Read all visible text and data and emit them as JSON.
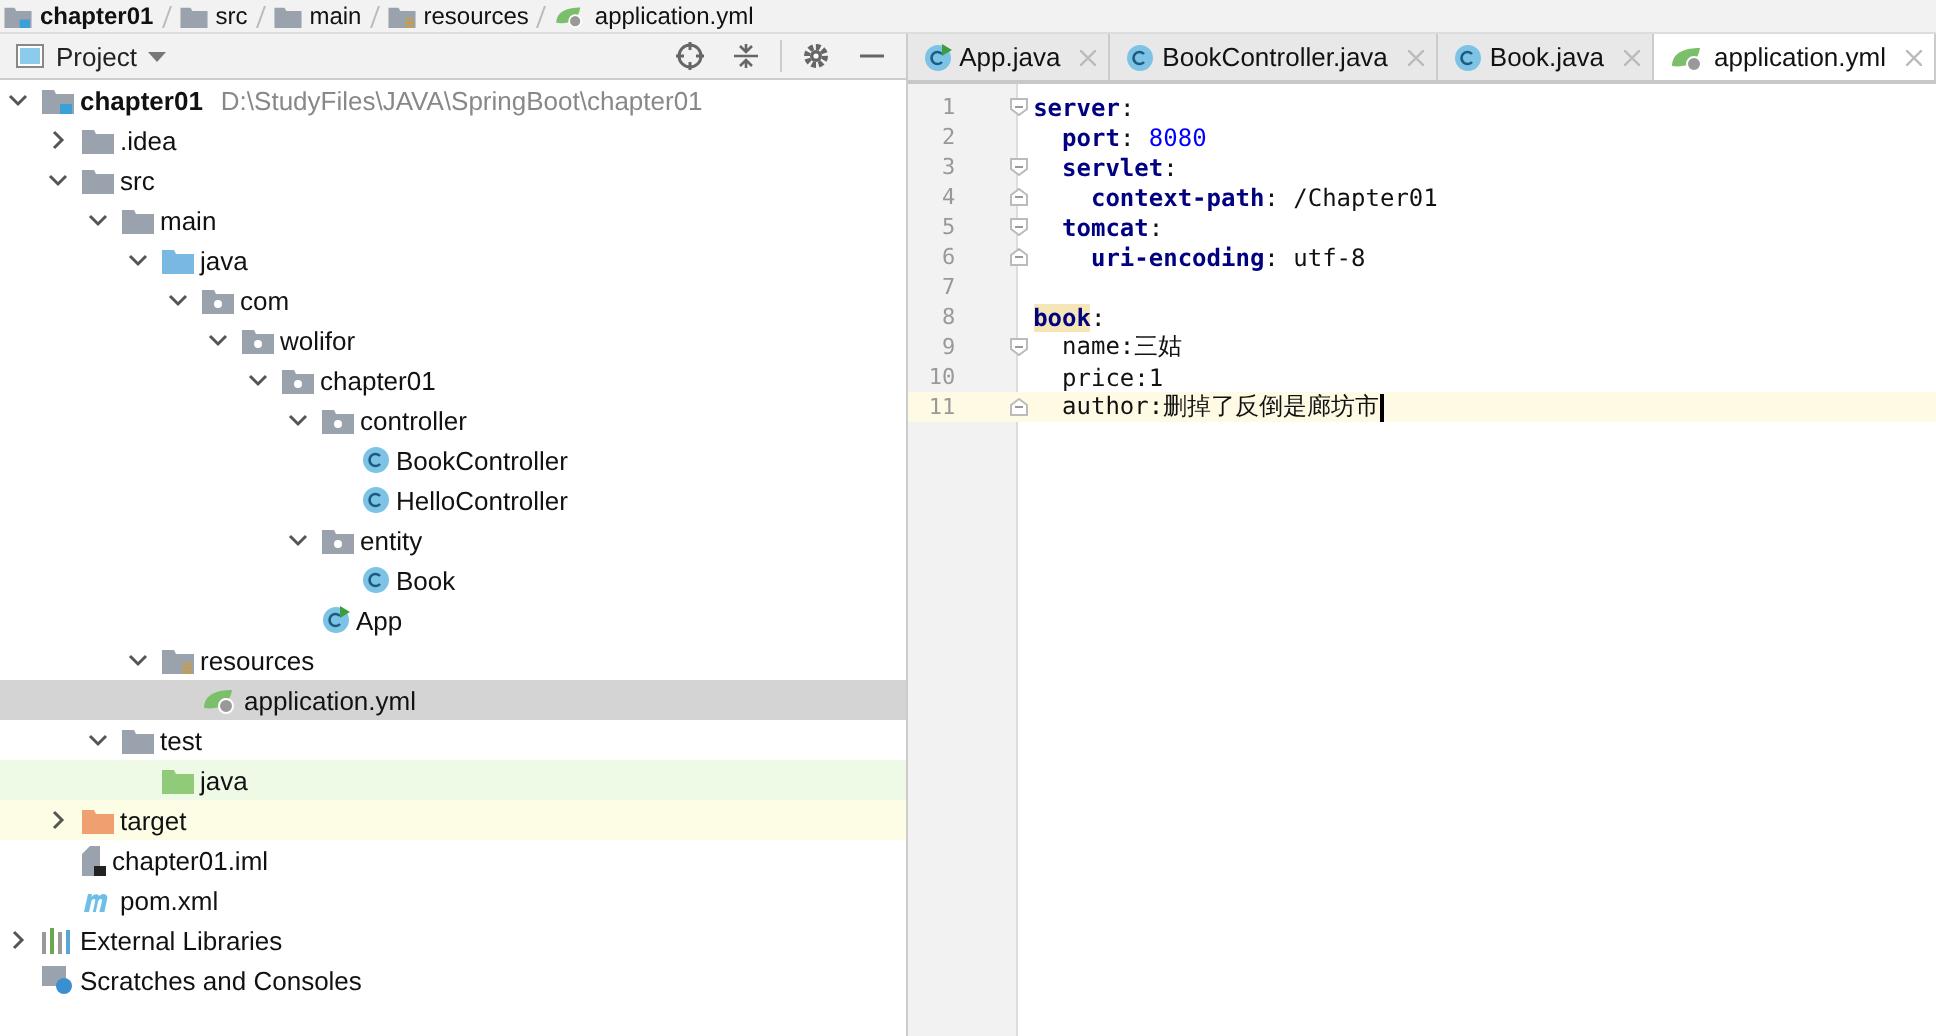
{
  "breadcrumb": [
    {
      "label": "chapter01",
      "kind": "module"
    },
    {
      "label": "src",
      "kind": "folder"
    },
    {
      "label": "main",
      "kind": "folder"
    },
    {
      "label": "resources",
      "kind": "resources"
    },
    {
      "label": "application.yml",
      "kind": "yml"
    }
  ],
  "project_panel": {
    "title": "Project",
    "tree": [
      {
        "label": "chapter01",
        "path": "D:\\StudyFiles\\JAVA\\SpringBoot\\chapter01",
        "kind": "module",
        "expanded": true,
        "selected": false,
        "children": [
          {
            "label": ".idea",
            "kind": "folder",
            "expanded": false,
            "selected": false
          },
          {
            "label": "src",
            "kind": "folder",
            "expanded": true,
            "selected": false,
            "children": [
              {
                "label": "main",
                "kind": "folder",
                "expanded": true,
                "selected": false,
                "children": [
                  {
                    "label": "java",
                    "kind": "source",
                    "expanded": true,
                    "selected": false,
                    "children": [
                      {
                        "label": "com",
                        "kind": "package",
                        "expanded": true,
                        "selected": false,
                        "children": [
                          {
                            "label": "wolifor",
                            "kind": "package",
                            "expanded": true,
                            "selected": false,
                            "children": [
                              {
                                "label": "chapter01",
                                "kind": "package",
                                "expanded": true,
                                "selected": false,
                                "children": [
                                  {
                                    "label": "controller",
                                    "kind": "package",
                                    "expanded": true,
                                    "selected": false,
                                    "children": [
                                      {
                                        "label": "BookController",
                                        "kind": "class",
                                        "selected": false
                                      },
                                      {
                                        "label": "HelloController",
                                        "kind": "class",
                                        "selected": false
                                      }
                                    ]
                                  },
                                  {
                                    "label": "entity",
                                    "kind": "package",
                                    "expanded": true,
                                    "selected": false,
                                    "children": [
                                      {
                                        "label": "Book",
                                        "kind": "class",
                                        "selected": false
                                      }
                                    ]
                                  },
                                  {
                                    "label": "App",
                                    "kind": "app",
                                    "selected": false
                                  }
                                ]
                              }
                            ]
                          }
                        ]
                      }
                    ]
                  },
                  {
                    "label": "resources",
                    "kind": "resources",
                    "expanded": true,
                    "selected": false,
                    "children": [
                      {
                        "label": "application.yml",
                        "kind": "yml",
                        "selected": true
                      }
                    ]
                  }
                ]
              },
              {
                "label": "test",
                "kind": "folder",
                "expanded": true,
                "selected": false,
                "children": [
                  {
                    "label": "java",
                    "kind": "test",
                    "selected": false
                  }
                ]
              }
            ]
          },
          {
            "label": "target",
            "kind": "excluded",
            "expanded": false,
            "selected": false
          },
          {
            "label": "chapter01.iml",
            "kind": "iml",
            "selected": false
          },
          {
            "label": "pom.xml",
            "kind": "maven",
            "selected": false
          }
        ]
      },
      {
        "label": "External Libraries",
        "kind": "libraries",
        "expanded": false,
        "selected": false
      },
      {
        "label": "Scratches and Consoles",
        "kind": "scratches",
        "selected": false
      }
    ]
  },
  "editor": {
    "tabs": [
      {
        "label": "App.java",
        "kind": "app",
        "selected": false
      },
      {
        "label": "BookController.java",
        "kind": "class",
        "selected": false
      },
      {
        "label": "Book.java",
        "kind": "class",
        "selected": false
      },
      {
        "label": "application.yml",
        "kind": "yml",
        "selected": true
      }
    ],
    "lines": [
      {
        "number": "1",
        "kind": "fold-start",
        "current": false,
        "segments": [
          {
            "text": "server",
            "kind": "key"
          },
          {
            "text": ":",
            "kind": "plain"
          }
        ]
      },
      {
        "number": "2",
        "current": false,
        "segments": [
          {
            "text": "  port",
            "kind": "key"
          },
          {
            "text": ": ",
            "kind": "plain"
          },
          {
            "text": "8080",
            "kind": "number"
          }
        ]
      },
      {
        "number": "3",
        "kind": "fold-start",
        "current": false,
        "segments": [
          {
            "text": "  servlet",
            "kind": "key"
          },
          {
            "text": ":",
            "kind": "plain"
          }
        ]
      },
      {
        "number": "4",
        "kind": "fold-end",
        "current": false,
        "segments": [
          {
            "text": "    context-path",
            "kind": "key"
          },
          {
            "text": ": /Chapter01",
            "kind": "plain"
          }
        ]
      },
      {
        "number": "5",
        "kind": "fold-start",
        "current": false,
        "segments": [
          {
            "text": "  tomcat",
            "kind": "key"
          },
          {
            "text": ":",
            "kind": "plain"
          }
        ]
      },
      {
        "number": "6",
        "kind": "fold-end",
        "current": false,
        "segments": [
          {
            "text": "    uri-encoding",
            "kind": "key"
          },
          {
            "text": ": utf-8",
            "kind": "plain"
          }
        ]
      },
      {
        "number": "7",
        "current": false
      },
      {
        "number": "8",
        "current": false,
        "segments": [
          {
            "text": "book",
            "kind": "matched-key"
          },
          {
            "text": ":",
            "kind": "plain"
          }
        ]
      },
      {
        "number": "9",
        "kind": "fold-start",
        "current": false,
        "segments": [
          {
            "text": "  name:三姑",
            "kind": "plain"
          }
        ]
      },
      {
        "number": "10",
        "current": false,
        "segments": [
          {
            "text": "  price:1",
            "kind": "plain"
          }
        ]
      },
      {
        "number": "11",
        "kind": "fold-end",
        "current": true,
        "segments": [
          {
            "text": "  author:删掉了反倒是廊坊市",
            "kind": "plain"
          }
        ]
      }
    ]
  }
}
